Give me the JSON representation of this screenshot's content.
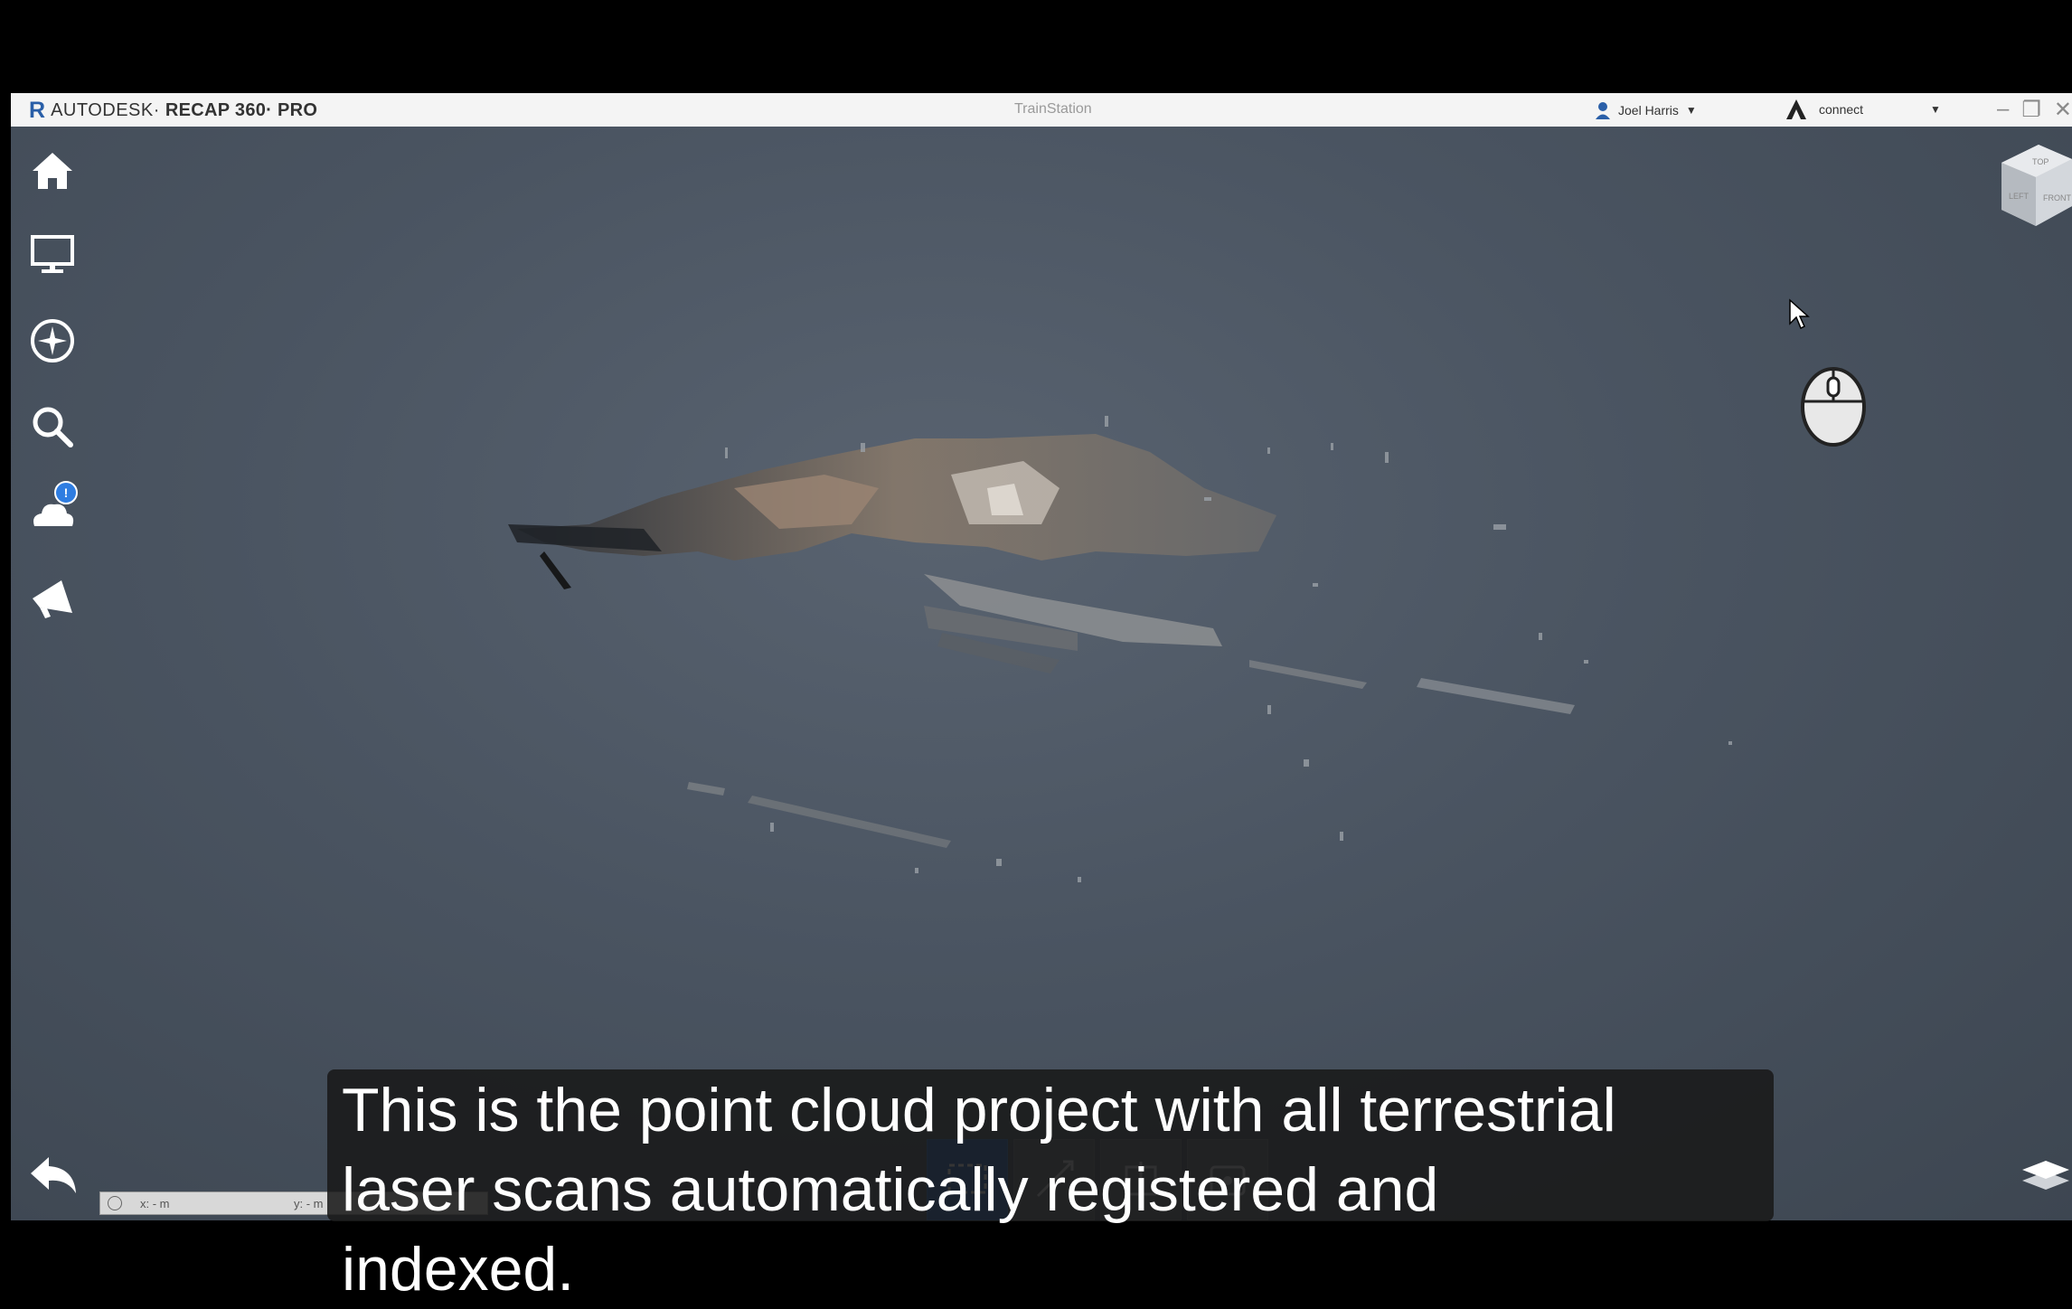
{
  "app": {
    "logo_letter": "R",
    "company": "AUTODESK·",
    "product": "RECAP 360· PRO",
    "document_title": "TrainStation"
  },
  "account": {
    "user_name": "Joel Harris",
    "connect_label": "connect"
  },
  "sidebar": {
    "items": [
      {
        "name": "home",
        "icon": "home-icon"
      },
      {
        "name": "display",
        "icon": "monitor-icon"
      },
      {
        "name": "navigate",
        "icon": "compass-icon"
      },
      {
        "name": "search",
        "icon": "search-icon"
      },
      {
        "name": "cloud",
        "icon": "cloud-icon",
        "badge": "!"
      },
      {
        "name": "announce",
        "icon": "megaphone-icon"
      }
    ]
  },
  "viewcube": {
    "faces": [
      "TOP",
      "LEFT",
      "FRONT"
    ]
  },
  "status": {
    "x_label": "x: - m",
    "y_label": "y: - m"
  },
  "bottom_tools": [
    {
      "name": "window-select",
      "icon": "select-rect-icon",
      "active": true
    },
    {
      "name": "measure",
      "icon": "measure-icon",
      "active": false
    },
    {
      "name": "clip",
      "icon": "clip-icon",
      "active": false
    },
    {
      "name": "region",
      "icon": "region-icon",
      "active": false
    }
  ],
  "caption": {
    "line1": "This is the point cloud project with all terrestrial",
    "line2": "laser scans automatically registered and",
    "line3": "indexed."
  },
  "colors": {
    "viewport_bg": "#4a5461",
    "accent": "#2a5fa8",
    "active_tool": "#1d5fb8"
  }
}
